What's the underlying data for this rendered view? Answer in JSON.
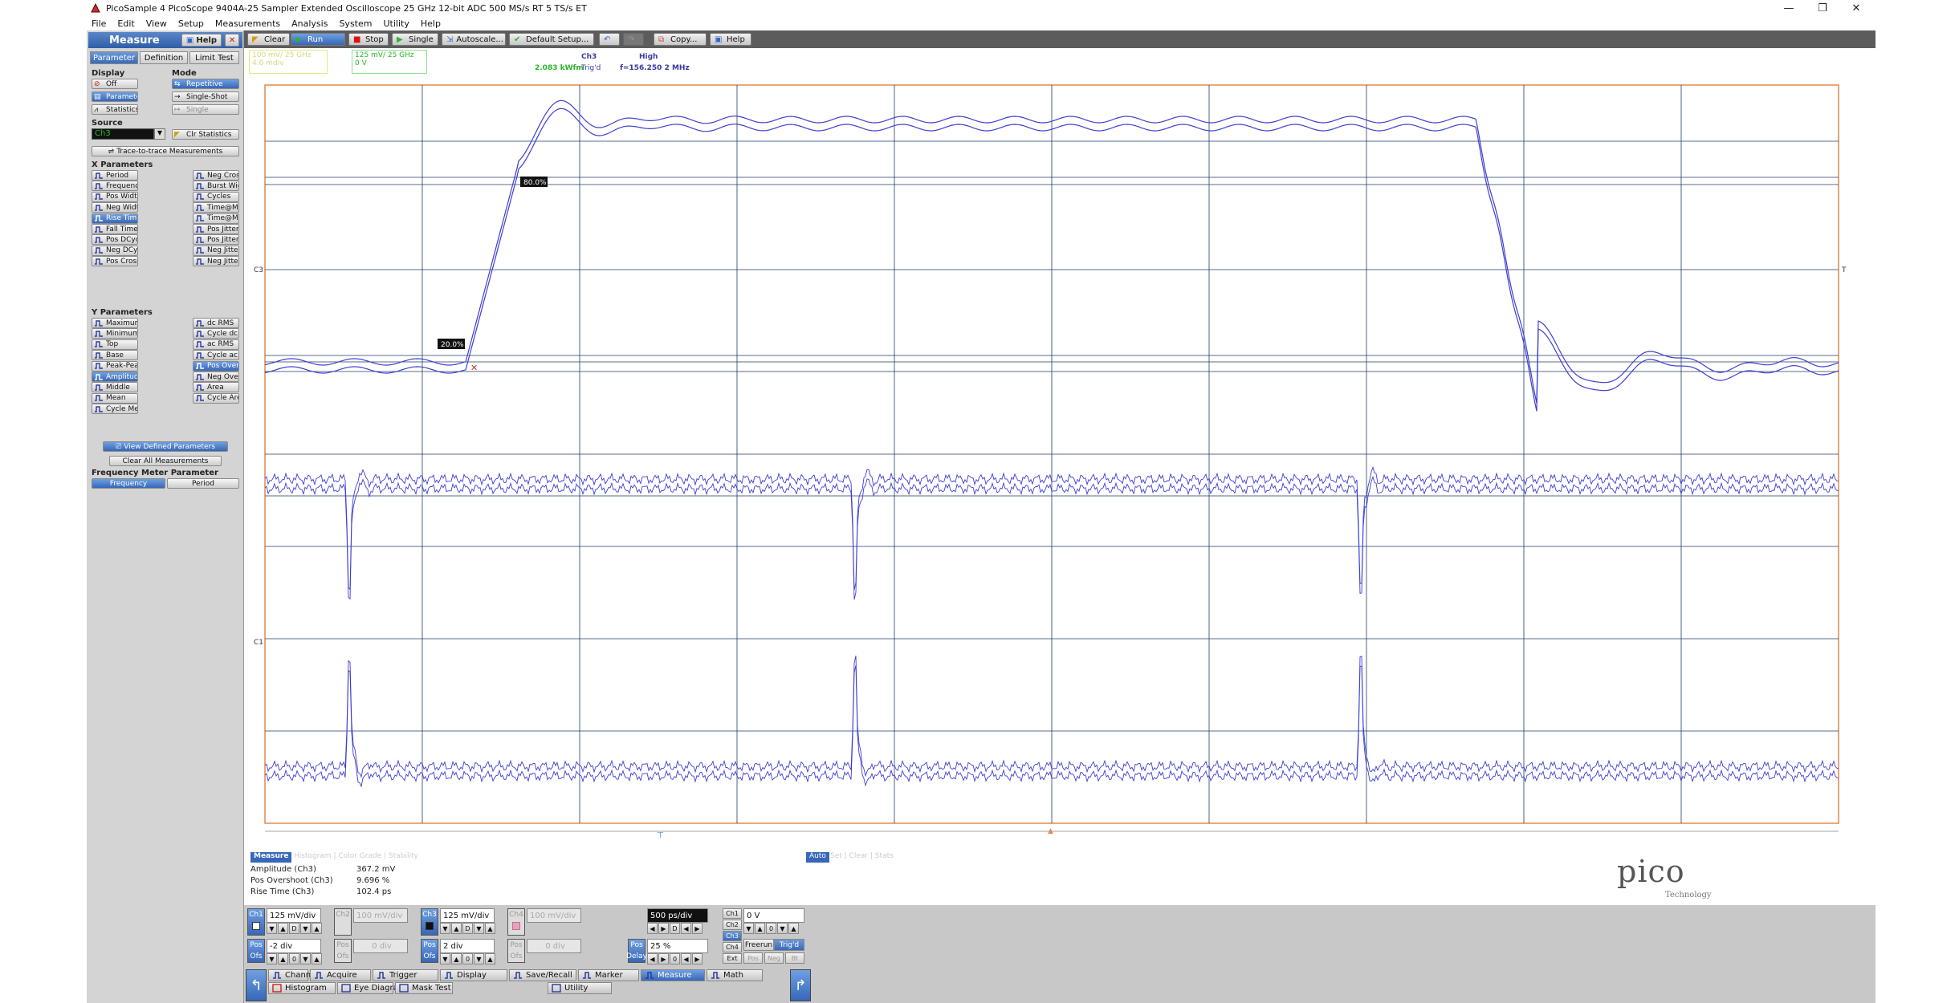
{
  "window": {
    "title": "PicoSample 4    PicoScope 9404A-25    Sampler Extended Oscilloscope    25 GHz   12-bit ADC   500 MS/s RT   5 TS/s ET"
  },
  "menu": [
    {
      "label": "File",
      "u": "F"
    },
    {
      "label": "Edit",
      "u": "E"
    },
    {
      "label": "View",
      "u": "V"
    },
    {
      "label": "Setup",
      "u": "S"
    },
    {
      "label": "Measurements",
      "u": "M"
    },
    {
      "label": "Analysis",
      "u": "A"
    },
    {
      "label": "System",
      "u": "y"
    },
    {
      "label": "Utility",
      "u": "U"
    },
    {
      "label": "Help",
      "u": "H"
    }
  ],
  "sidebar": {
    "title": "Measure",
    "help": "Help",
    "tabs": [
      "Parameter",
      "Definition",
      "Limit Test"
    ],
    "display_label": "Display",
    "mode_label": "Mode",
    "display_items": [
      "Off",
      "Parameters",
      "Statistics"
    ],
    "mode_items": [
      "Repetitive",
      "Single-Shot",
      "Single"
    ],
    "source_label": "Source",
    "source_value": "Ch3",
    "clr_statistics": "Clr Statistics",
    "trace_to_trace": "Trace-to-trace Measurements",
    "x_params_label": "X Parameters",
    "x_params_left": [
      "Period",
      "Frequency",
      "Pos Width",
      "Neg Width",
      "Rise Time",
      "Fall Time",
      "Pos DCycle",
      "Neg DCycle",
      "Pos Cross"
    ],
    "x_params_right": [
      "Neg Cross",
      "Burst Width",
      "Cycles",
      "Time@Max",
      "Time@Min",
      "Pos Jitter pp",
      "Pos Jitter rms",
      "Neg Jitter pp",
      "Neg Jitter rms"
    ],
    "y_params_label": "Y Parameters",
    "y_params_left": [
      "Maximum",
      "Minimum",
      "Top",
      "Base",
      "Peak-Peak",
      "Amplitude",
      "Middle",
      "Mean",
      "Cycle Mean"
    ],
    "y_params_right": [
      "dc RMS",
      "Cycle dc RMS",
      "ac RMS",
      "Cycle ac RMS",
      "Pos Overshoot",
      "Neg Overshoot",
      "Area",
      "Cycle Area"
    ],
    "view_defined": "View Defined Parameters",
    "clear_all": "Clear All Measurements",
    "freq_meter_label": "Frequency Meter Parameter",
    "freq_buttons": [
      "Frequency",
      "Period"
    ]
  },
  "toolbar": {
    "clear": "Clear",
    "run": "Run",
    "stop": "Stop",
    "single": "Single",
    "autoscale": "Autoscale...",
    "default_setup": "Default Setup...",
    "copy": "Copy...",
    "help": "Help"
  },
  "info": {
    "ch1_box": {
      "line1": "100 mV/   25 GHz",
      "line2": "4.0 mdiv"
    },
    "ch3_box": {
      "line1": "125 mV/    25 GHz",
      "line2": "0 V"
    },
    "trigger": {
      "src": "Ch3",
      "level": "High",
      "rate": "2.083 kWfm",
      "state": "Trig'd",
      "freq": "f=156.250 2 MHz"
    }
  },
  "scope": {
    "markers": {
      "p80": "80.0%",
      "p20": "20.0%"
    },
    "labels": {
      "c3": "C3",
      "c1": "C1",
      "t": "T"
    }
  },
  "measurements": {
    "tab": "Measure",
    "tabs_dim": "Histogram | Color Grade | Stability",
    "auto": "Auto",
    "auto_extra": "Set | Clear | Stats",
    "rows": [
      {
        "name": "Amplitude (Ch3)",
        "value": "367.2 mV"
      },
      {
        "name": "Pos Overshoot (Ch3)",
        "value": "9.696 %"
      },
      {
        "name": "Rise Time (Ch3)",
        "value": "102.4 ps"
      }
    ]
  },
  "logo": {
    "text": "pico",
    "sub": "Technology"
  },
  "bottom": {
    "ch1": {
      "label": "Ch1",
      "scale": "125 mV/div",
      "pos": "-2 div"
    },
    "ch2": {
      "label": "Ch2",
      "scale": "100 mV/div",
      "pos": "0 div"
    },
    "ch3": {
      "label": "Ch3",
      "scale": "125 mV/div",
      "pos": "2 div"
    },
    "ch4": {
      "label": "Ch4",
      "scale": "100 mV/div",
      "pos": "0 div"
    },
    "pos_label": "Pos",
    "ofs_label": "Ofs",
    "timebase": "500 ps/div",
    "delay_pct": "25 %",
    "delay_label": "Delay",
    "trig_sources": [
      "Ch1",
      "Ch2",
      "Ch3",
      "Ch4",
      "Ext"
    ],
    "trig_level": "0 V",
    "freerun": "Freerun",
    "trigd": "Trig'd",
    "pos_neg": [
      "Pos",
      "Neg",
      "Bt"
    ],
    "nav_row1": [
      "Channels",
      "Acquire",
      "Trigger",
      "Display",
      "Save/Recall",
      "Marker",
      "Measure",
      "Math"
    ],
    "nav_row2": [
      "Histogram",
      "Eye Diagram",
      "Mask Test",
      "Utility"
    ]
  },
  "colors": {
    "trace": "#3f3fd0",
    "grid": "#1f3d64",
    "frame": "#e08a50",
    "accent": "#3767b8",
    "green": "#2ab52a"
  }
}
